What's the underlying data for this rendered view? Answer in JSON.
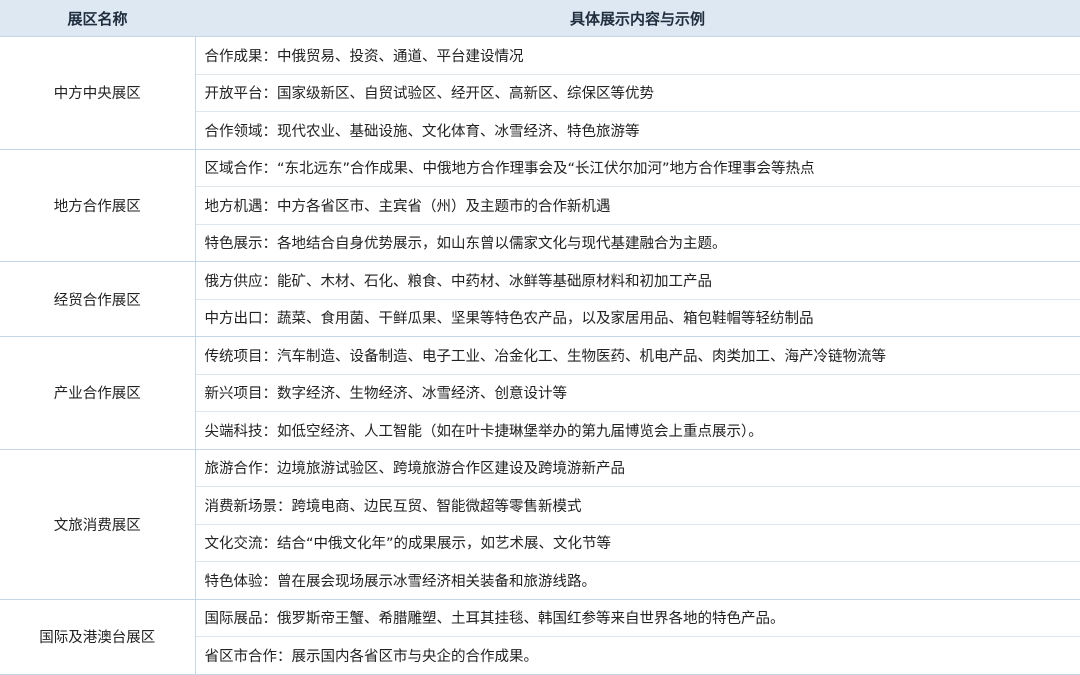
{
  "header": {
    "col_zone": "展区名称",
    "col_content": "具体展示内容与示例"
  },
  "groups": [
    {
      "zone": "中方中央展区",
      "items": [
        "合作成果：中俄贸易、投资、通道、平台建设情况",
        "开放平台：国家级新区、自贸试验区、经开区、高新区、综保区等优势",
        "合作领域：现代农业、基础设施、文化体育、冰雪经济、特色旅游等"
      ]
    },
    {
      "zone": "地方合作展区",
      "items": [
        "区域合作：“东北远东”合作成果、中俄地方合作理事会及“长江伏尔加河”地方合作理事会等热点",
        "地方机遇：中方各省区市、主宾省（州）及主题市的合作新机遇",
        "特色展示：各地结合自身优势展示，如山东曾以儒家文化与现代基建融合为主题。"
      ]
    },
    {
      "zone": "经贸合作展区",
      "items": [
        "俄方供应：能矿、木材、石化、粮食、中药材、冰鲜等基础原材料和初加工产品",
        "中方出口：蔬菜、食用菌、干鲜瓜果、坚果等特色农产品，以及家居用品、箱包鞋帽等轻纺制品"
      ]
    },
    {
      "zone": "产业合作展区",
      "items": [
        "传统项目：汽车制造、设备制造、电子工业、冶金化工、生物医药、机电产品、肉类加工、海产冷链物流等",
        "新兴项目：数字经济、生物经济、冰雪经济、创意设计等",
        "尖端科技：如低空经济、人工智能（如在叶卡捷琳堡举办的第九届博览会上重点展示）。"
      ]
    },
    {
      "zone": "文旅消费展区",
      "items": [
        "旅游合作：边境旅游试验区、跨境旅游合作区建设及跨境游新产品",
        "消费新场景：跨境电商、边民互贸、智能微超等零售新模式",
        "文化交流：结合“中俄文化年”的成果展示，如艺术展、文化节等",
        "特色体验：曾在展会现场展示冰雪经济相关装备和旅游线路。"
      ]
    },
    {
      "zone": "国际及港澳台展区",
      "items": [
        "国际展品：俄罗斯帝王蟹、希腊雕塑、土耳其挂毯、韩国红参等来自世界各地的特色产品。",
        "省区市合作：展示国内各省区市与央企的合作成果。"
      ]
    }
  ]
}
